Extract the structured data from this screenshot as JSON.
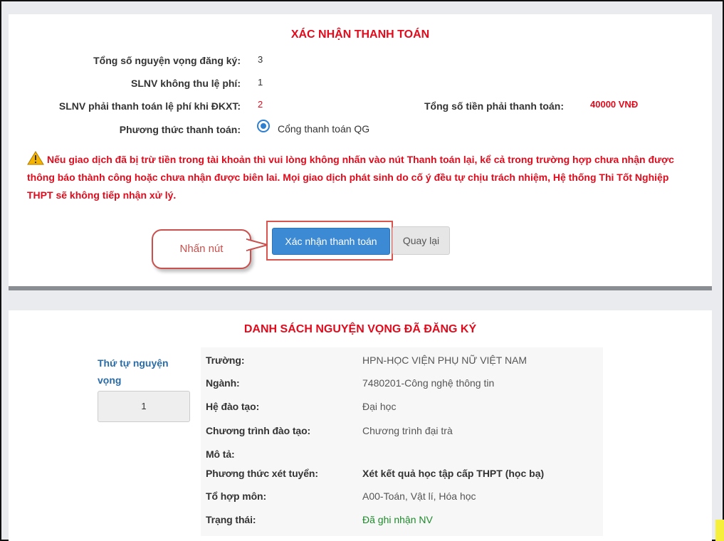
{
  "payment": {
    "title": "XÁC NHẬN THANH TOÁN",
    "rows": [
      {
        "label": "Tổng số nguyện vọng đăng ký:",
        "value": "3"
      },
      {
        "label": "SLNV không thu lệ phí:",
        "value": "1"
      },
      {
        "label": "SLNV phải thanh toán lệ phí khi ĐKXT:",
        "value": "2"
      },
      {
        "label": "Phương thức thanh toán:",
        "value": "Cổng thanh toán QG"
      }
    ],
    "total_label": "Tổng số tiền phải thanh toán:",
    "total_value": "40000 VNĐ",
    "warning": "Nếu giao dịch đã bị trừ tiền trong tài khoản thì vui lòng không nhấn vào nút Thanh toán lại, kể cả trong trường hợp chưa nhận được thông báo thành công hoặc chưa nhận được biên lai. Mọi giao dịch phát sinh do cố ý đều tự chịu trách nhiệm, Hệ thống Thi Tốt Nghiệp THPT sẽ không tiếp nhận xử lý.",
    "confirm_button": "Xác nhận thanh toán",
    "back_button": "Quay lại",
    "callout": "Nhấn nút"
  },
  "list": {
    "title": "DANH SÁCH NGUYỆN VỌNG ĐÃ ĐĂNG KÝ",
    "order_label": "Thứ tự nguyện vọng",
    "order_value": "1",
    "details": [
      {
        "key": "Trường:",
        "value": "HPN-HỌC VIỆN PHỤ NỮ VIỆT NAM"
      },
      {
        "key": "Ngành:",
        "value": "7480201-Công nghệ thông tin"
      },
      {
        "key": "Hệ đào tạo:",
        "value": "Đại học"
      },
      {
        "key": "Chương trình đào tạo:",
        "value": "Chương trình đại trà"
      },
      {
        "key": "Mô tả:",
        "value": ""
      },
      {
        "key": "Phương thức xét tuyển:",
        "value": "Xét kết quả học tập cấp THPT (học bạ)"
      },
      {
        "key": "Tổ hợp môn:",
        "value": "A00-Toán, Vật lí, Hóa học"
      },
      {
        "key": "Trạng thái:",
        "value": "Đã ghi nhận NV"
      }
    ]
  },
  "colors": {
    "accent_red": "#e00b1c",
    "primary_blue": "#3c8ad3",
    "status_green": "#1e8a2b"
  }
}
